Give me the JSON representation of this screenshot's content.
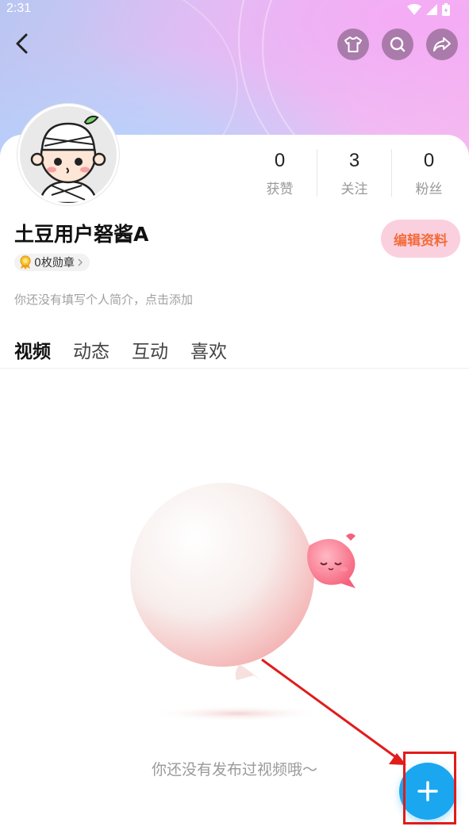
{
  "status_bar": {
    "time": "2:31"
  },
  "profile": {
    "name": "土豆用户砮酱A",
    "badge": "0枚勋章",
    "bio_placeholder": "你还没有填写个人简介，点击添加",
    "edit_label": "编辑资料"
  },
  "stats": [
    {
      "value": "0",
      "label": "获赞"
    },
    {
      "value": "3",
      "label": "关注"
    },
    {
      "value": "0",
      "label": "粉丝"
    }
  ],
  "tabs": [
    {
      "label": "视频",
      "active": true
    },
    {
      "label": "动态",
      "active": false
    },
    {
      "label": "互动",
      "active": false
    },
    {
      "label": "喜欢",
      "active": false
    }
  ],
  "empty_state": {
    "text": "你还没有发布过视频哦～"
  },
  "icons": {
    "back": "back-arrow-icon",
    "wardrobe": "tshirt-icon",
    "search": "search-icon",
    "share": "share-icon",
    "add": "plus-icon"
  },
  "colors": {
    "fab": "#1aa7f0",
    "edit_button_bg": "#fbd0de",
    "edit_button_text": "#f26c3a",
    "annotation": "#e21b1b"
  }
}
